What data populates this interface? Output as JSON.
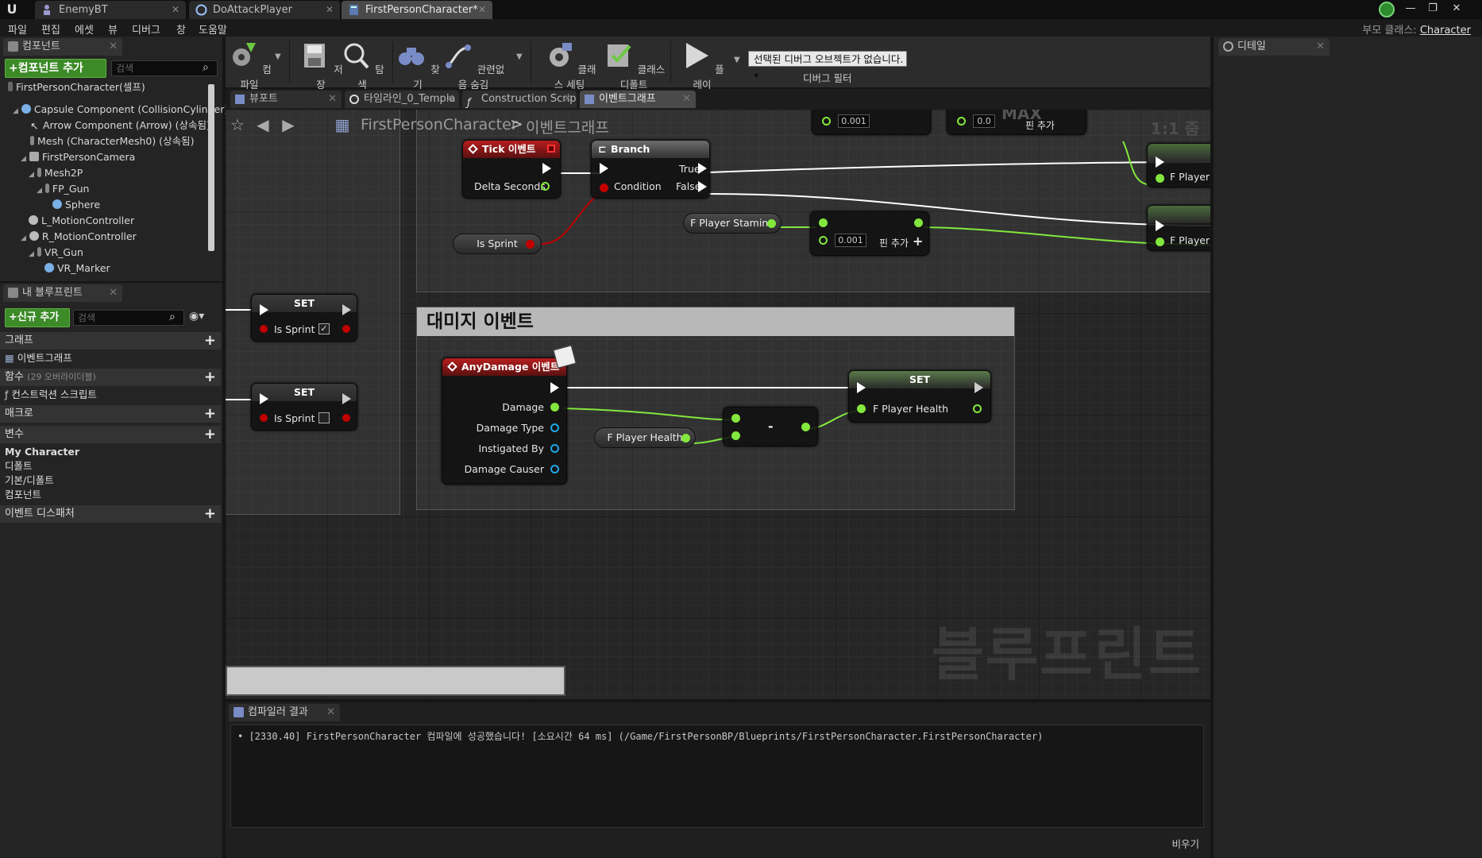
{
  "titlebar": {
    "tabs": [
      {
        "label": "EnemyBT",
        "icon": "behavior-tree-icon"
      },
      {
        "label": "DoAttackPlayer",
        "icon": "task-icon"
      },
      {
        "label": "FirstPersonCharacter*",
        "icon": "blueprint-icon"
      }
    ]
  },
  "menubar": {
    "items": [
      "파일",
      "편집",
      "에셋",
      "뷰",
      "디버그",
      "창",
      "도움말"
    ],
    "parent_class_label": "부모 클래스:",
    "parent_class_value": "Character"
  },
  "components_panel": {
    "tab_label": "컴포넌트",
    "add_button": "+컴포넌트 추가",
    "search_placeholder": "검색",
    "tree": [
      {
        "label": "FirstPersonCharacter(셀프)"
      },
      {
        "label": "Capsule Component (CollisionCylinder)"
      },
      {
        "label": "Arrow Component (Arrow) (상속됨)"
      },
      {
        "label": "Mesh (CharacterMesh0) (상속됨)"
      },
      {
        "label": "FirstPersonCamera"
      },
      {
        "label": "Mesh2P"
      },
      {
        "label": "FP_Gun"
      },
      {
        "label": "Sphere"
      },
      {
        "label": "L_MotionController"
      },
      {
        "label": "R_MotionController"
      },
      {
        "label": "VR_Gun"
      },
      {
        "label": "VR_Marker"
      }
    ]
  },
  "my_blueprint": {
    "tab_label": "내 블루프린트",
    "add_button": "+신규 추가",
    "search_placeholder": "검색",
    "graphs_label": "그래프",
    "event_graph_label": "이벤트그래프",
    "functions_label": "함수",
    "functions_sub": "(29 오버라이더블)",
    "construction_label": "컨스트럭션 스크립트",
    "macros_label": "매크로",
    "variables_label": "변수",
    "var_categories": [
      "My Character",
      "디폴트",
      "기본/디폴트",
      "컴포넌트"
    ],
    "dispatchers_label": "이벤트 디스패처"
  },
  "toolbar": {
    "compile": "컴파일",
    "save": "저장",
    "browse": "탐색",
    "find": "찾기",
    "hide_unrelated": "관련없음 숨김",
    "class_settings": "클래스 세팅",
    "class_defaults": "클래스 디폴트",
    "play": "플레이",
    "debug_select": "선택된 디버그 오브젝트가 없습니다.",
    "debug_filter": "디버그 필터"
  },
  "graph_tabs": [
    {
      "label": "뷰포트"
    },
    {
      "label": "타임라인_0_Templa"
    },
    {
      "label": "Construction Scrip"
    },
    {
      "label": "이벤트그래프"
    }
  ],
  "graph": {
    "breadcrumb_class": "FirstPersonCharacter",
    "breadcrumb_sep": ">",
    "breadcrumb_graph": "이벤트그래프",
    "zoom": "1:1 줌",
    "watermark": "블루프린트",
    "max_label": "MAX",
    "comment_title": "대미지 이벤트",
    "tick_node": {
      "title": "Tick 이벤트",
      "pin": "Delta Seconds"
    },
    "branch_node": {
      "title": "Branch",
      "condition": "Condition",
      "true": "True",
      "false": "False"
    },
    "is_sprint_var": "Is Sprint",
    "stamina_var": "F Player Stamina",
    "add_pin": "핀 추가",
    "value_0001": "0.001",
    "value_00": "0.0",
    "set_true": {
      "title": "SET",
      "pin": "Is Sprint"
    },
    "set_false": {
      "title": "SET",
      "pin": "Is Sprint"
    },
    "right_pin_1": "F Player S",
    "right_pin_2": "F Player S",
    "anydamage_node": {
      "title": "AnyDamage 이벤트",
      "pins": [
        "Damage",
        "Damage Type",
        "Instigated By",
        "Damage Causer"
      ]
    },
    "health_var": "F Player Health",
    "minus": "-",
    "set_health": {
      "title": "SET",
      "pin": "F Player Health"
    }
  },
  "compiler": {
    "tab_label": "컴파일러 결과",
    "log": "• [2330.40] FirstPersonCharacter 컴파일에 성공했습니다! [소요시간 64 ms] (/Game/FirstPersonBP/Blueprints/FirstPersonCharacter.FirstPersonCharacter)",
    "clear": "비우기"
  },
  "details": {
    "tab_label": "디테일"
  }
}
